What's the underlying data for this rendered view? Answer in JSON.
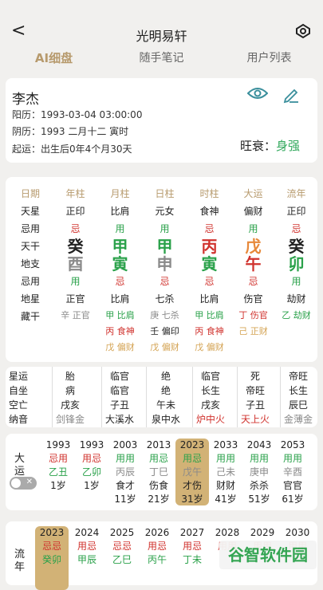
{
  "header": {
    "title": "光明易轩"
  },
  "tabs": [
    "AI细盘",
    "随手笔记",
    "用户列表"
  ],
  "profile": {
    "name": "李杰",
    "solar": "阳历：1993-03-04 03:00:00",
    "lunar": "阴历：1993 二月十二 寅时",
    "qiyun": "起运：出生后0年4个月30天",
    "ws_label": "旺衰：",
    "ws_value": "身强"
  },
  "pillar_rows": [
    "日期",
    "天星",
    "忌用",
    "天干",
    "地支",
    "忌用",
    "地星",
    "藏干"
  ],
  "pillars": [
    {
      "head": "年柱",
      "tx": "正印",
      "j1": "忌",
      "gan": "癸",
      "zhi": "酉",
      "j2": "用",
      "dx": "正官",
      "cg": [
        "辛 正官"
      ]
    },
    {
      "head": "月柱",
      "tx": "比肩",
      "j1": "用",
      "gan": "甲",
      "zhi": "寅",
      "j2": "忌",
      "dx": "比肩",
      "cg": [
        "甲 比肩",
        "丙 食神",
        "戊 偏财"
      ]
    },
    {
      "head": "日柱",
      "tx": "元女",
      "j1": "用",
      "gan": "甲",
      "zhi": "申",
      "j2": "忌",
      "dx": "七杀",
      "cg": [
        "庚 七杀",
        "壬 偏印",
        "戊 偏财"
      ]
    },
    {
      "head": "时柱",
      "tx": "食神",
      "j1": "忌",
      "gan": "丙",
      "zhi": "寅",
      "j2": "忌",
      "dx": "比肩",
      "cg": [
        "甲 比肩",
        "丙 食神",
        "戊 偏财"
      ]
    },
    {
      "head": "大运",
      "tx": "偏财",
      "j1": "用",
      "gan": "戊",
      "zhi": "午",
      "j2": "忌",
      "dx": "伤官",
      "cg": [
        "丁 伤官",
        "己 正财"
      ]
    },
    {
      "head": "流年",
      "tx": "正印",
      "j1": "忌",
      "gan": "癸",
      "zhi": "卯",
      "j2": "用",
      "dx": "劫财",
      "cg": [
        "乙 劫财"
      ]
    }
  ],
  "star_labels": [
    "星运",
    "自坐",
    "空亡",
    "纳音"
  ],
  "stars": [
    [
      "胎",
      "病",
      "戌亥",
      "剑锋金"
    ],
    [
      "临官",
      "临官",
      "子丑",
      "大溪水"
    ],
    [
      "绝",
      "绝",
      "午未",
      "泉中水"
    ],
    [
      "临官",
      "长生",
      "戌亥",
      "炉中火"
    ],
    [
      "死",
      "帝旺",
      "子丑",
      "天上火"
    ],
    [
      "帝旺",
      "长生",
      "辰巳",
      "金薄金"
    ]
  ],
  "dayun_label": "大运",
  "dayun": [
    {
      "year": "1993",
      "j": "忌用",
      "gz": "乙丑",
      "ss": "",
      "age": "1岁"
    },
    {
      "year": "1993",
      "j": "用忌",
      "gz": "乙卯",
      "ss": "",
      "age": "1岁"
    },
    {
      "year": "2003",
      "j": "用用",
      "gz": "丙辰",
      "ss": "食才",
      "age": "11岁"
    },
    {
      "year": "2013",
      "j": "用忌",
      "gz": "丁巳",
      "ss": "伤食",
      "age": "21岁"
    },
    {
      "year": "2023",
      "j": "用忌",
      "gz": "戊午",
      "ss": "才伤",
      "age": "31岁"
    },
    {
      "year": "2033",
      "j": "用用",
      "gz": "己未",
      "ss": "财财",
      "age": "41岁"
    },
    {
      "year": "2043",
      "j": "用用",
      "gz": "庚申",
      "ss": "杀杀",
      "age": "51岁"
    },
    {
      "year": "2053",
      "j": "用用",
      "gz": "辛酉",
      "ss": "官官",
      "age": "61岁"
    }
  ],
  "liunian_label": "流年",
  "liunian": [
    {
      "year": "2023",
      "j": "忌忌",
      "gz": "癸卯"
    },
    {
      "year": "2024",
      "j": "用忌",
      "gz": "甲辰"
    },
    {
      "year": "2025",
      "j": "忌忌",
      "gz": "乙巳"
    },
    {
      "year": "2026",
      "j": "用忌",
      "gz": "丙午"
    },
    {
      "year": "2027",
      "j": "用忌",
      "gz": "丁未"
    },
    {
      "year": "2028",
      "j": "用用",
      "gz": ""
    },
    {
      "year": "2029",
      "j": "用用",
      "gz": ""
    },
    {
      "year": "2030",
      "j": "用用",
      "gz": ""
    }
  ],
  "watermark": "谷智软件园"
}
